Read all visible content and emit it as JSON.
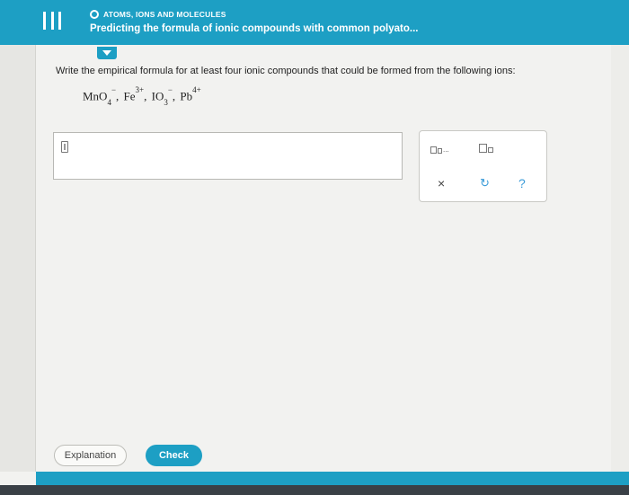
{
  "header": {
    "topic": "ATOMS, IONS AND MOLECULES",
    "title": "Predicting the formula of ionic compounds with common polyato..."
  },
  "question": {
    "prompt": "Write the empirical formula for at least four ionic compounds that could be formed from the following ions:",
    "ions": [
      {
        "base": "MnO",
        "sub": "4",
        "sup": "−",
        "sep": ","
      },
      {
        "base": "Fe",
        "sub": "",
        "sup": "3+",
        "sep": ","
      },
      {
        "base": "IO",
        "sub": "3",
        "sup": "−",
        "sep": ","
      },
      {
        "base": "Pb",
        "sub": "",
        "sup": "4+",
        "sep": ""
      }
    ]
  },
  "tools": {
    "clear_symbol": "×",
    "undo_symbol": "↻",
    "help_symbol": "?",
    "ellipsis": "..."
  },
  "footer": {
    "explanation_label": "Explanation",
    "check_label": "Check"
  },
  "colors": {
    "accent": "#1d9fc4",
    "background": "#f2f2f0"
  }
}
